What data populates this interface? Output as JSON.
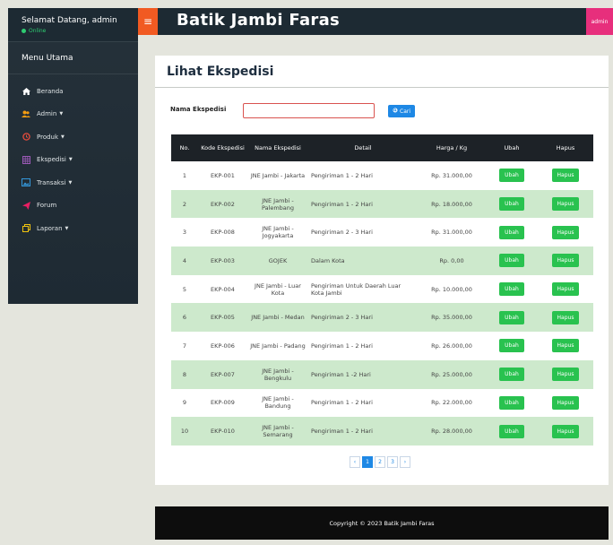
{
  "sidebar": {
    "user_greeting": "Selamat Datang, admin",
    "status": "Online",
    "menu_header": "Menu Utama",
    "items": [
      {
        "label": "Beranda",
        "icon": "home-icon",
        "color": "#ffffff",
        "has_caret": false
      },
      {
        "label": "Admin",
        "icon": "users-icon",
        "color": "#f39c12",
        "has_caret": true
      },
      {
        "label": "Produk",
        "icon": "clock-icon",
        "color": "#e74c3c",
        "has_caret": true
      },
      {
        "label": "Ekspedisi",
        "icon": "grid-icon",
        "color": "#9b59b6",
        "has_caret": true
      },
      {
        "label": "Transaksi",
        "icon": "image-icon",
        "color": "#3498db",
        "has_caret": true
      },
      {
        "label": "Forum",
        "icon": "send-icon",
        "color": "#e91e63",
        "has_caret": false
      },
      {
        "label": "Laporan",
        "icon": "copy-icon",
        "color": "#f1c40f",
        "has_caret": true
      }
    ]
  },
  "topbar": {
    "menu_icon": "hamburger-icon",
    "brand": "Batik Jambi Faras",
    "user": "admin",
    "accent": "#f15a22",
    "badge_color": "#e72f7c"
  },
  "main": {
    "title": "Lihat Ekspedisi",
    "search": {
      "label": "Nama Ekspedisi",
      "value": "",
      "placeholder": "",
      "button_label": "Cari",
      "button_icon": "search-icon"
    },
    "table": {
      "headers": [
        "No.",
        "Kode Ekspedisi",
        "Nama Ekspedisi",
        "Detail",
        "Harga / Kg",
        "Ubah",
        "Hapus"
      ],
      "rows": [
        {
          "no": "1",
          "kode": "EKP-001",
          "nama": "JNE Jambi - Jakarta",
          "detail": "Pengiriman 1 - 2 Hari",
          "harga": "Rp. 31.000,00"
        },
        {
          "no": "2",
          "kode": "EKP-002",
          "nama": "JNE Jambi - Palembang",
          "detail": "Pengiriman 1 - 2 Hari",
          "harga": "Rp. 18.000,00"
        },
        {
          "no": "3",
          "kode": "EKP-008",
          "nama": "JNE Jambi - Jogyakarta",
          "detail": "Pengiriman 2 - 3 Hari",
          "harga": "Rp. 31.000,00"
        },
        {
          "no": "4",
          "kode": "EKP-003",
          "nama": "GOJEK",
          "detail": "Dalam Kota",
          "harga": "Rp. 0,00"
        },
        {
          "no": "5",
          "kode": "EKP-004",
          "nama": "JNE Jambi - Luar Kota",
          "detail": "Pengiriman Untuk Daerah Luar Kota Jambi",
          "harga": "Rp. 10.000,00"
        },
        {
          "no": "6",
          "kode": "EKP-005",
          "nama": "JNE Jambi - Medan",
          "detail": "Pengiriman 2 - 3 Hari",
          "harga": "Rp. 35.000,00"
        },
        {
          "no": "7",
          "kode": "EKP-006",
          "nama": "JNE Jambi - Padang",
          "detail": "Pengiriman 1 - 2 Hari",
          "harga": "Rp. 26.000,00"
        },
        {
          "no": "8",
          "kode": "EKP-007",
          "nama": "JNE Jambi - Bengkulu",
          "detail": "Pengiriman 1 -2 Hari",
          "harga": "Rp. 25.000,00"
        },
        {
          "no": "9",
          "kode": "EKP-009",
          "nama": "JNE Jambi - Bandung",
          "detail": "Pengiriman 1 - 2 Hari",
          "harga": "Rp. 22.000,00"
        },
        {
          "no": "10",
          "kode": "EKP-010",
          "nama": "JNE Jambi - Semarang",
          "detail": "Pengiriman 1 - 2 Hari",
          "harga": "Rp. 28.000,00"
        }
      ],
      "edit_label": "Ubah",
      "delete_label": "Hapus",
      "button_color": "#29c24f",
      "row_alt_color": "#cde9cc"
    },
    "pagination": {
      "prev": "‹",
      "pages": [
        "1",
        "2",
        "3"
      ],
      "active": "1",
      "next": "›"
    }
  },
  "footer": {
    "text": "Copyright © 2023 Batik Jambi Faras"
  }
}
